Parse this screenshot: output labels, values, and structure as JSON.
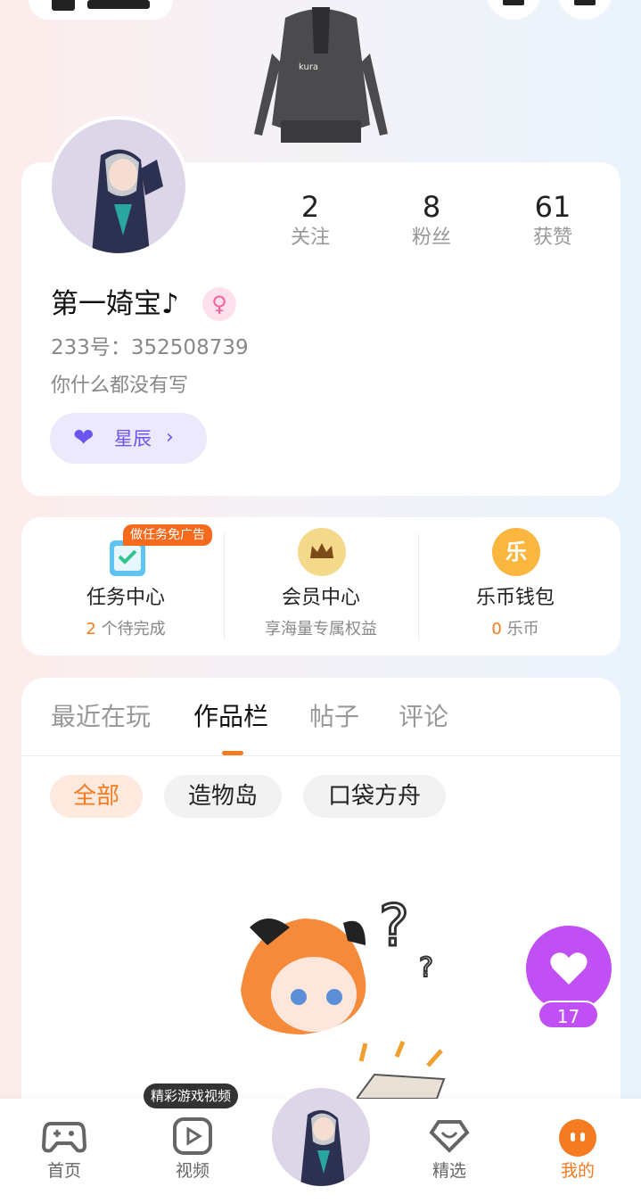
{
  "profile": {
    "stats": [
      {
        "num": "2",
        "label": "关注"
      },
      {
        "num": "8",
        "label": "粉丝"
      },
      {
        "num": "61",
        "label": "获赞"
      }
    ],
    "nickname": "第一婍宝♪",
    "gender_symbol": "♀",
    "uid": "233号：352508739",
    "bio": "你什么都没有写",
    "badge_label": "星辰"
  },
  "menu": {
    "promo": "做任务免广告",
    "items": [
      {
        "title": "任务中心",
        "sub_num": "2",
        "sub_text": " 个待完成"
      },
      {
        "title": "会员中心",
        "sub_text": "享海量专属权益"
      },
      {
        "title": "乐币钱包",
        "sub_num": "0",
        "sub_text": " 乐币",
        "icon_text": "乐"
      }
    ]
  },
  "tabs": [
    "最近在玩",
    "作品栏",
    "帖子",
    "评论"
  ],
  "chips": [
    "全部",
    "造物岛",
    "口袋方舟"
  ],
  "fav_count": "17",
  "nav": {
    "tip": "精彩游戏视频",
    "items": [
      "首页",
      "视频",
      "精选",
      "我的"
    ]
  },
  "colors": {
    "accent": "#f47b20",
    "purple": "#c04ff4",
    "badge": "#6b55f0"
  }
}
